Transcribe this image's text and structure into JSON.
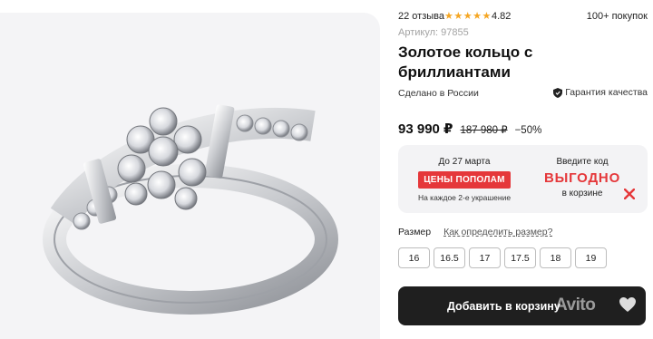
{
  "product": {
    "reviews": "22 отзыва",
    "rating": "4.82",
    "stars": "★★★★★",
    "purchases": "100+ покупок",
    "sku": "Артикул: 97855",
    "title": "Золотое кольцо с бриллиантами",
    "origin": "Сделано в России",
    "quality": "Гарантия качества",
    "image_icon": "diamond-ring-icon"
  },
  "price": {
    "current": "93 990 ₽",
    "old": "187 980 ₽",
    "discount": "−50%"
  },
  "promo": {
    "date": "До 27 марта",
    "badge": "ЦЕНЫ ПОПОЛАМ",
    "note": "На каждое 2-е украшение",
    "code_label": "Введите код",
    "code": "ВЫГОДНО",
    "code_note": "в корзине",
    "accent_color": "#e5373a"
  },
  "size": {
    "label": "Размер",
    "help_link": "Как определить размер?",
    "options": [
      "16",
      "16.5",
      "17",
      "17.5",
      "18",
      "19"
    ]
  },
  "cart": {
    "button_label": "Добавить в корзину",
    "watermark": "Avito",
    "favorite_icon": "heart-icon"
  }
}
